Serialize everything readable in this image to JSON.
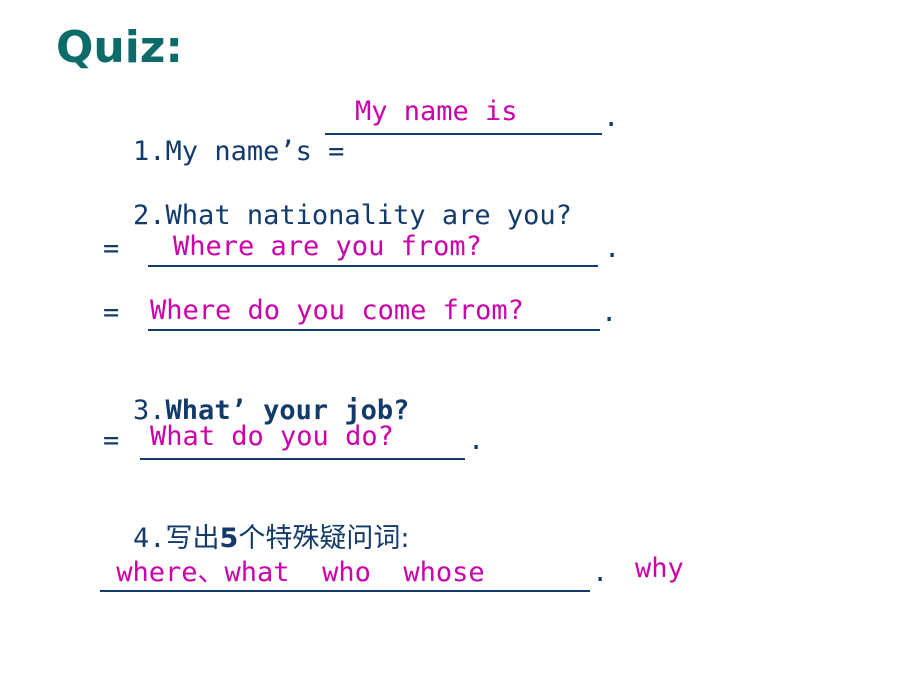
{
  "slide": {
    "title": "Quiz:",
    "title_color": "#0d6b69",
    "question_color": "#123a6b",
    "answer_color": "#cc00aa",
    "background_color": "#ffffff"
  },
  "items": [
    {
      "number": "1.",
      "prompt": "My name’s =",
      "answer": "My name is",
      "trailing": "."
    },
    {
      "number": "2.",
      "prompt": "What nationality are you?",
      "answers": [
        {
          "equals": "=",
          "text": "Where are you from?",
          "trailing": "."
        },
        {
          "equals": "=",
          "text": "Where do you come from?",
          "trailing": "."
        }
      ]
    },
    {
      "number": "3.",
      "prompt": "What’ your job?",
      "answers": [
        {
          "equals": "=",
          "text": "What do you do?",
          "trailing": "."
        }
      ]
    },
    {
      "number": "4.",
      "prompt_pre": "写出",
      "prompt_count": "5",
      "prompt_post": "个特殊疑问词:",
      "answer_underlined": " where、what  who  whose",
      "answer_trailing": ".",
      "answer_extra": "why"
    }
  ]
}
